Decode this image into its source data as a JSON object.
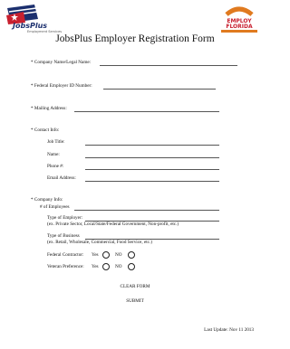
{
  "header": {
    "logo_left_text": "JobsPlus",
    "logo_left_sub": "Employment Services",
    "logo_right_text": "EMPLOY FLORIDA",
    "title": "JobsPlus Employer Registration Form"
  },
  "fields": {
    "company_name": "* Company Name/Legal Name:",
    "federal_id": "* Federal Employer ID Number:",
    "mailing_address": "* Mailing Address:",
    "contact_info": "* Contact Info:",
    "job_title": "Job Title:",
    "name": "Name:",
    "phone": "Phone #:",
    "email": "Email Address:",
    "company_info": "* Company Info:",
    "employees": "# of Employees",
    "type_employer": "Type of Employer:",
    "type_employer_hint": "(ex. Private Sector, Local/State/Federal Government, Non-profit, etc.)",
    "type_business": "Type of Business",
    "type_business_hint": "(ex. Retail, Wholesale, Commercial, Food Service, etc.)",
    "federal_contractor": "Federal Contractor:",
    "veteran_preference": "Veteran Preference:",
    "yes": "Yes",
    "no": "NO"
  },
  "actions": {
    "clear": "CLEAR FORM",
    "submit": "SUBMIT"
  },
  "footer": {
    "last_update": "Last Update: Nov 11 2013"
  },
  "colors": {
    "navy": "#1b2f6e",
    "red": "#c8202f",
    "orange": "#e07a1f"
  }
}
